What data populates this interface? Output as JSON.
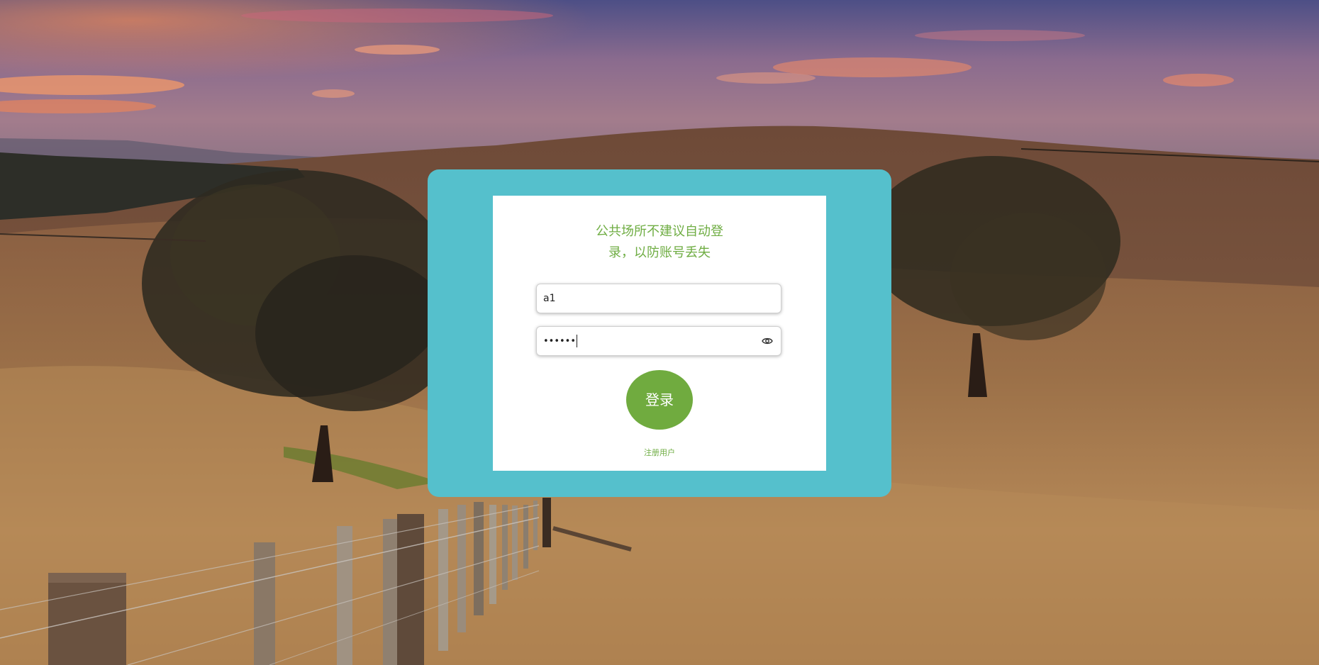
{
  "login": {
    "notice_line1": "公共场所不建议自动登",
    "notice_line2": "录，以防账号丢失",
    "username_value": "a1",
    "password_value": "••••••",
    "login_label": "登录",
    "register_label": "注册用户"
  },
  "icons": {
    "password_toggle": "eye-icon"
  },
  "colors": {
    "frame": "#55c0cc",
    "card": "#ffffff",
    "accent_green": "#70ab3f",
    "notice_text": "#6fad43"
  }
}
